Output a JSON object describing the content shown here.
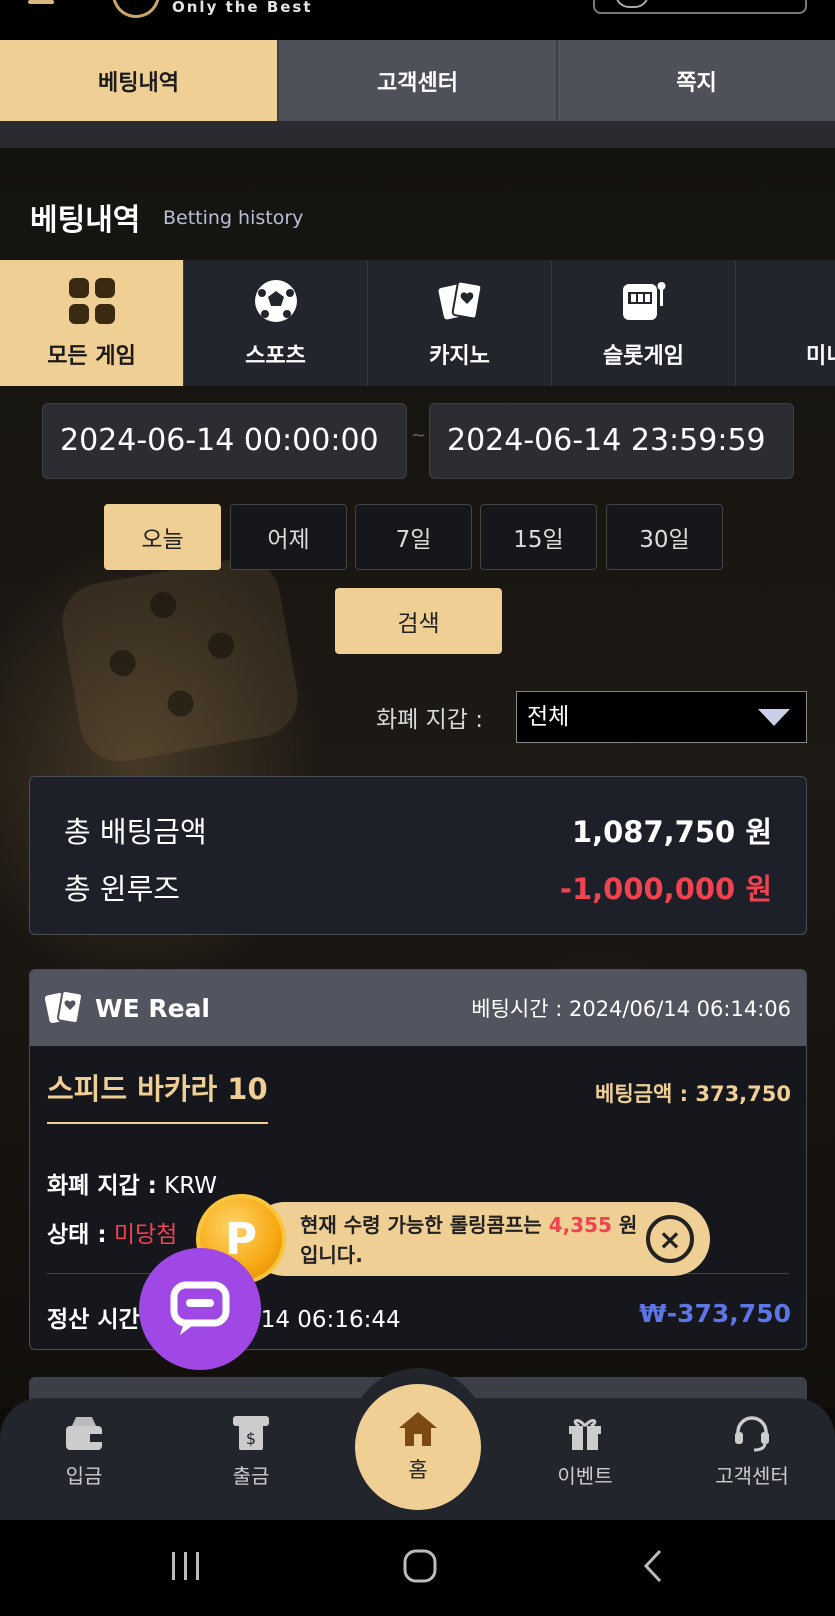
{
  "header": {
    "slogan": "Only the Best"
  },
  "top_tabs": [
    {
      "label": "베팅내역",
      "active": true
    },
    {
      "label": "고객센터",
      "active": false
    },
    {
      "label": "쪽지",
      "active": false
    }
  ],
  "section": {
    "title": "베팅내역",
    "subtitle": "Betting history"
  },
  "categories": [
    {
      "label": "모든 게임",
      "icon": "grid-icon",
      "active": true
    },
    {
      "label": "스포츠",
      "icon": "soccer-ball-icon",
      "active": false
    },
    {
      "label": "카지노",
      "icon": "playing-cards-icon",
      "active": false
    },
    {
      "label": "슬롯게임",
      "icon": "slot-machine-icon",
      "active": false
    },
    {
      "label": "미니",
      "icon": "roulette-icon",
      "active": false
    }
  ],
  "date_range": {
    "start": "2024-06-14 00:00:00",
    "end": "2024-06-14 23:59:59",
    "separator": "~"
  },
  "quick_ranges": [
    {
      "label": "오늘",
      "active": true
    },
    {
      "label": "어제",
      "active": false
    },
    {
      "label": "7일",
      "active": false
    },
    {
      "label": "15일",
      "active": false
    },
    {
      "label": "30일",
      "active": false
    }
  ],
  "search_label": "검색",
  "wallet_filter": {
    "label": "화폐 지갑 :",
    "selected": "전체"
  },
  "summary": {
    "total_bet_label": "총 배팅금액",
    "total_bet_value": "1,087,750 원",
    "total_winloss_label": "총 윈루즈",
    "total_winloss_value": "-1,000,000 원"
  },
  "bet_card": {
    "provider": "WE Real",
    "bet_time_label": "베팅시간 :",
    "bet_time": "2024/06/14 06:14:06",
    "game_name": "스피드 바카라 10",
    "bet_amount_label": "베팅금액 :",
    "bet_amount": "373,750",
    "wallet_label": "화폐 지갑 :",
    "wallet_value": "KRW",
    "status_label": "상태 :",
    "status_value": "미당첨",
    "settle_label": "정산 시간",
    "settle_time": "/14 06:16:44",
    "settle_amount": "₩-373,750"
  },
  "toast": {
    "coin_letter": "P",
    "text_before": "현재 수령 가능한 롤링콤프는",
    "amount": "4,355",
    "text_after": "원",
    "text_line2": "입니다.",
    "close_glyph": "×"
  },
  "bottom_nav": [
    {
      "label": "입금",
      "icon": "wallet-icon"
    },
    {
      "label": "출금",
      "icon": "withdraw-icon"
    },
    {
      "label": "홈",
      "icon": "home-icon"
    },
    {
      "label": "이벤트",
      "icon": "gift-icon"
    },
    {
      "label": "고객센터",
      "icon": "headset-icon"
    }
  ],
  "colors": {
    "accent": "#f0cf95",
    "negative": "#f0424f",
    "settle_blue": "#5d75e6",
    "chat_purple": "#a048e6"
  }
}
